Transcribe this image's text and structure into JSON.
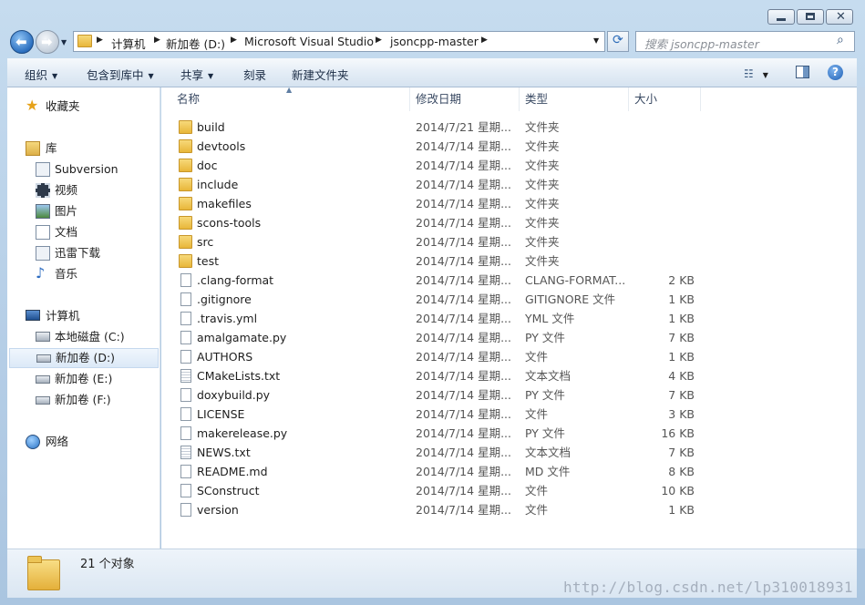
{
  "window": {
    "caption_buttons": [
      "minimize",
      "maximize",
      "close"
    ]
  },
  "address_bar": {
    "crumbs": [
      "计算机",
      "新加卷 (D:)",
      "Microsoft Visual Studio",
      "jsoncpp-master"
    ]
  },
  "search": {
    "placeholder": "搜索 jsoncpp-master"
  },
  "toolbar": {
    "organize": "组织",
    "include_in_library": "包含到库中",
    "share": "共享",
    "burn": "刻录",
    "new_folder": "新建文件夹"
  },
  "nav": {
    "favorites": "收藏夹",
    "libraries": "库",
    "lib_items": [
      "Subversion",
      "视频",
      "图片",
      "文档",
      "迅雷下载",
      "音乐"
    ],
    "computer": "计算机",
    "drives": [
      "本地磁盘 (C:)",
      "新加卷 (D:)",
      "新加卷 (E:)",
      "新加卷 (F:)"
    ],
    "selected_drive": "新加卷 (D:)",
    "network": "网络"
  },
  "columns": {
    "name": "名称",
    "date": "修改日期",
    "type": "类型",
    "size": "大小"
  },
  "files": [
    {
      "name": "build",
      "date": "2014/7/21 星期...",
      "type": "文件夹",
      "size": "",
      "kind": "folder"
    },
    {
      "name": "devtools",
      "date": "2014/7/14 星期...",
      "type": "文件夹",
      "size": "",
      "kind": "folder"
    },
    {
      "name": "doc",
      "date": "2014/7/14 星期...",
      "type": "文件夹",
      "size": "",
      "kind": "folder"
    },
    {
      "name": "include",
      "date": "2014/7/14 星期...",
      "type": "文件夹",
      "size": "",
      "kind": "folder"
    },
    {
      "name": "makefiles",
      "date": "2014/7/14 星期...",
      "type": "文件夹",
      "size": "",
      "kind": "folder"
    },
    {
      "name": "scons-tools",
      "date": "2014/7/14 星期...",
      "type": "文件夹",
      "size": "",
      "kind": "folder"
    },
    {
      "name": "src",
      "date": "2014/7/14 星期...",
      "type": "文件夹",
      "size": "",
      "kind": "folder"
    },
    {
      "name": "test",
      "date": "2014/7/14 星期...",
      "type": "文件夹",
      "size": "",
      "kind": "folder"
    },
    {
      "name": ".clang-format",
      "date": "2014/7/14 星期...",
      "type": "CLANG-FORMAT...",
      "size": "2 KB",
      "kind": "file"
    },
    {
      "name": ".gitignore",
      "date": "2014/7/14 星期...",
      "type": "GITIGNORE 文件",
      "size": "1 KB",
      "kind": "file"
    },
    {
      "name": ".travis.yml",
      "date": "2014/7/14 星期...",
      "type": "YML 文件",
      "size": "1 KB",
      "kind": "file"
    },
    {
      "name": "amalgamate.py",
      "date": "2014/7/14 星期...",
      "type": "PY 文件",
      "size": "7 KB",
      "kind": "file"
    },
    {
      "name": "AUTHORS",
      "date": "2014/7/14 星期...",
      "type": "文件",
      "size": "1 KB",
      "kind": "file"
    },
    {
      "name": "CMakeLists.txt",
      "date": "2014/7/14 星期...",
      "type": "文本文档",
      "size": "4 KB",
      "kind": "text"
    },
    {
      "name": "doxybuild.py",
      "date": "2014/7/14 星期...",
      "type": "PY 文件",
      "size": "7 KB",
      "kind": "file"
    },
    {
      "name": "LICENSE",
      "date": "2014/7/14 星期...",
      "type": "文件",
      "size": "3 KB",
      "kind": "file"
    },
    {
      "name": "makerelease.py",
      "date": "2014/7/14 星期...",
      "type": "PY 文件",
      "size": "16 KB",
      "kind": "file"
    },
    {
      "name": "NEWS.txt",
      "date": "2014/7/14 星期...",
      "type": "文本文档",
      "size": "7 KB",
      "kind": "text"
    },
    {
      "name": "README.md",
      "date": "2014/7/14 星期...",
      "type": "MD 文件",
      "size": "8 KB",
      "kind": "file"
    },
    {
      "name": "SConstruct",
      "date": "2014/7/14 星期...",
      "type": "文件",
      "size": "10 KB",
      "kind": "file"
    },
    {
      "name": "version",
      "date": "2014/7/14 星期...",
      "type": "文件",
      "size": "1 KB",
      "kind": "file"
    }
  ],
  "status": {
    "count": "21 个对象"
  },
  "watermark": "http://blog.csdn.net/lp310018931"
}
